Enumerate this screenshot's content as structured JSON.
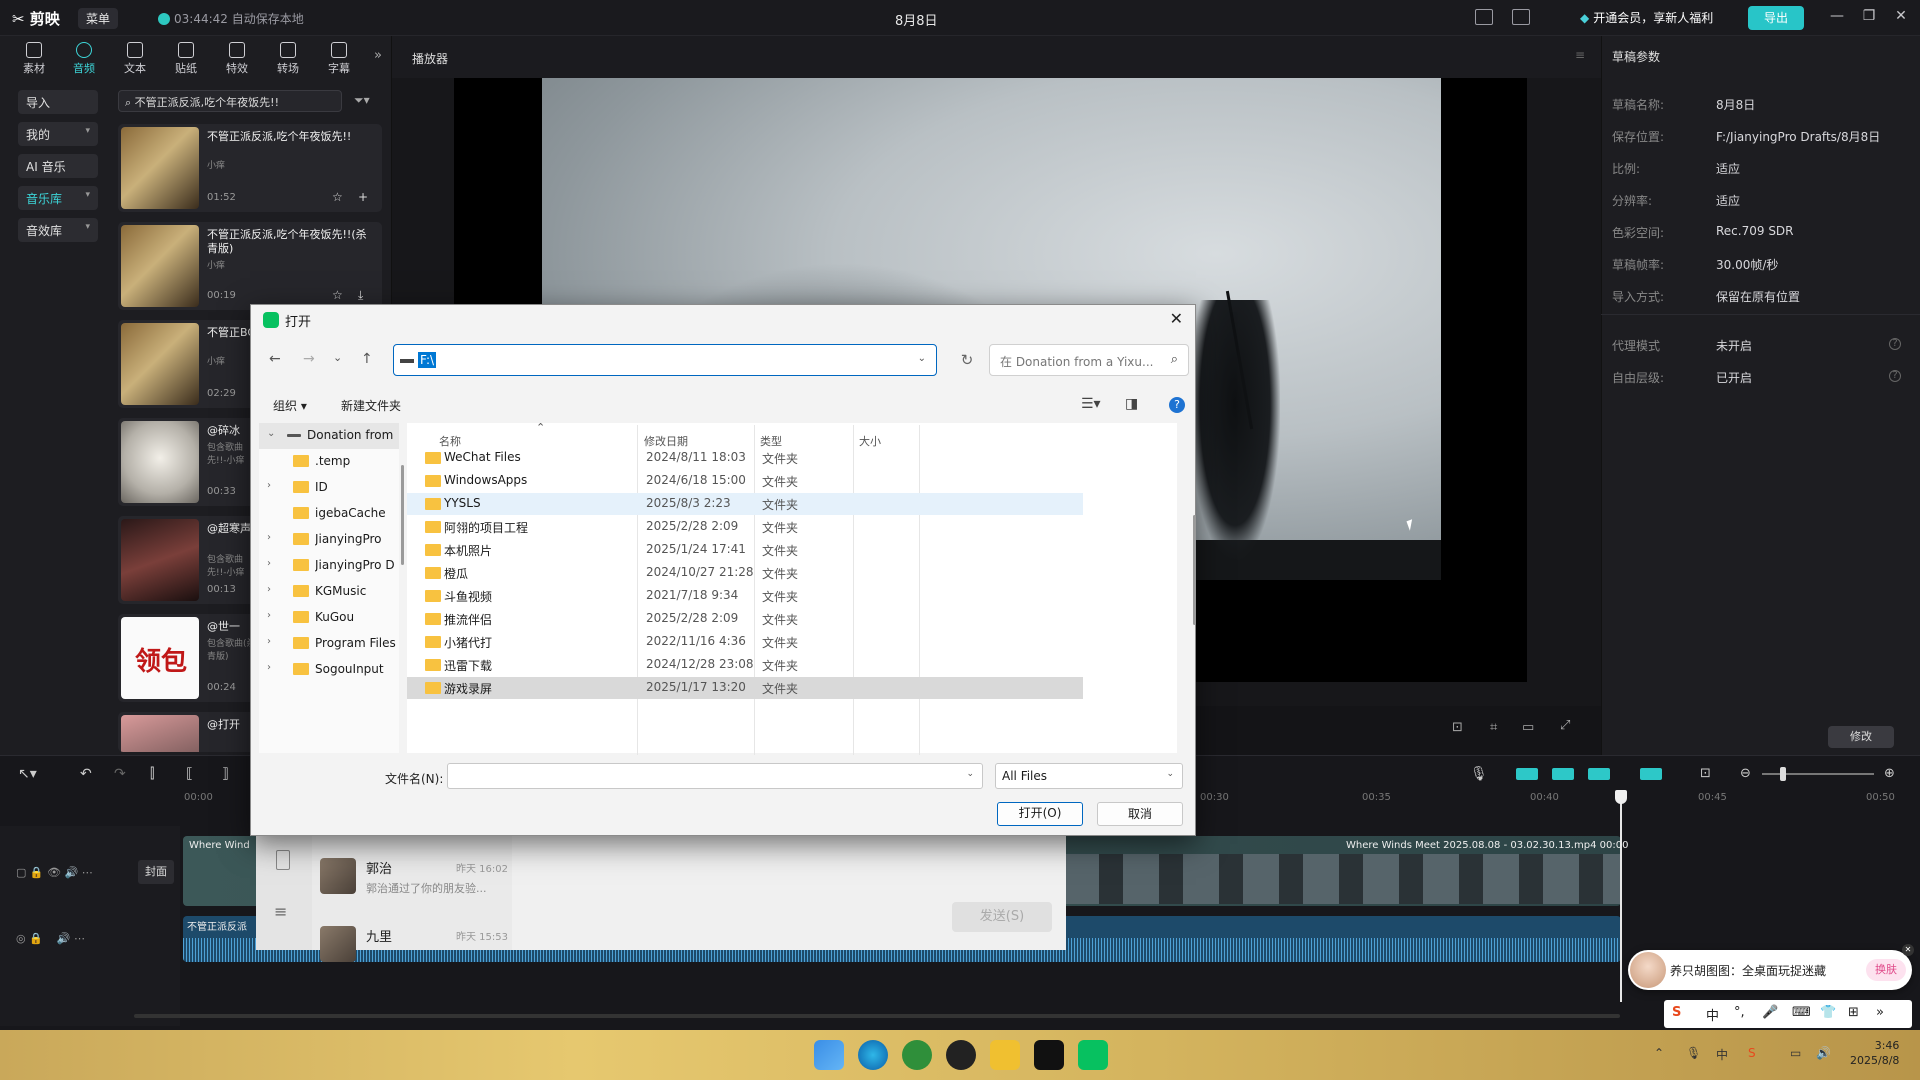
{
  "app": {
    "logo": "✂ 剪映",
    "menu": "菜单",
    "autosave": "03:44:42 自动保存本地",
    "doc_title": "8月8日",
    "vip": "开通会员，享新人福利",
    "export": "导出"
  },
  "toolbar": [
    {
      "label": "素材"
    },
    {
      "label": "音频"
    },
    {
      "label": "文本"
    },
    {
      "label": "贴纸"
    },
    {
      "label": "特效"
    },
    {
      "label": "转场"
    },
    {
      "label": "字幕"
    }
  ],
  "sidebar": [
    {
      "label": "导入",
      "chev": ""
    },
    {
      "label": "我的",
      "chev": "▾"
    },
    {
      "label": "AI 音乐",
      "chev": ""
    },
    {
      "label": "音乐库",
      "chev": "▾"
    },
    {
      "label": "音效库",
      "chev": "▾"
    }
  ],
  "music_search": "不管正派反派,吃个年夜饭先!!",
  "music_list": [
    {
      "title": "不管正派反派,吃个年夜饭先!!",
      "sub": "小痒",
      "dur": "01:52"
    },
    {
      "title": "不管正派反派,吃个年夜饭先!!(杀青版)",
      "sub": "小痒",
      "dur": "00:19"
    },
    {
      "title": "不管正BGM官",
      "sub": "小痒",
      "dur": "02:29"
    },
    {
      "title": "@碎冰",
      "sub": "包含歌曲先!!-小痒",
      "dur": "00:33"
    },
    {
      "title": "@超寒声",
      "sub": "包含歌曲先!!-小痒",
      "dur": "00:13"
    },
    {
      "title": "@世一",
      "sub": "包含歌曲(杀青版)",
      "dur": "00:24"
    },
    {
      "title": "@打开",
      "sub": "",
      "dur": ""
    }
  ],
  "player": {
    "title": "播放器"
  },
  "draft": {
    "title": "草稿参数",
    "rows": [
      {
        "k": "草稿名称:",
        "v": "8月8日"
      },
      {
        "k": "保存位置:",
        "v": "F:/JianyingPro Drafts/8月8日"
      },
      {
        "k": "比例:",
        "v": "适应"
      },
      {
        "k": "分辨率:",
        "v": "适应"
      },
      {
        "k": "色彩空间:",
        "v": "Rec.709 SDR"
      },
      {
        "k": "草稿帧率:",
        "v": "30.00帧/秒"
      },
      {
        "k": "导入方式:",
        "v": "保留在原有位置"
      }
    ],
    "rows2": [
      {
        "k": "代理模式",
        "v": "未开启"
      },
      {
        "k": "自由层级:",
        "v": "已开启"
      }
    ],
    "modify": "修改"
  },
  "timeline": {
    "ruler": [
      "00:00",
      "00:30",
      "00:35",
      "00:40",
      "00:45",
      "00:50"
    ],
    "cover": "封面",
    "video_clip": "Where Winds Meet 2025.08.08 - 03.02.30.13.mp4  00:00",
    "video_clip_left": "Where Wind",
    "audio_clip_left": "不管正派反派"
  },
  "chat": {
    "items": [
      {
        "name": "郭治",
        "time": "昨天 16:02",
        "msg": "郭治通过了你的朋友验..."
      },
      {
        "name": "九里",
        "time": "昨天 15:53",
        "msg": ""
      }
    ],
    "send": "发送(S)"
  },
  "dialog": {
    "title": "打开",
    "address": "F:\\",
    "search_placeholder": "在 Donation from a Yixu...",
    "organize": "组织 ▾",
    "new_folder": "新建文件夹",
    "headers": {
      "name": "名称",
      "date": "修改日期",
      "type": "类型",
      "size": "大小"
    },
    "tree": [
      {
        "label": "Donation from",
        "twisty": "⌄",
        "root": true
      },
      {
        "label": ".temp",
        "twisty": ""
      },
      {
        "label": "ID",
        "twisty": "›"
      },
      {
        "label": "igebaCache",
        "twisty": ""
      },
      {
        "label": "JianyingPro",
        "twisty": "›"
      },
      {
        "label": "JianyingPro D",
        "twisty": "›"
      },
      {
        "label": "KGMusic",
        "twisty": "›"
      },
      {
        "label": "KuGou",
        "twisty": "›"
      },
      {
        "label": "Program Files",
        "twisty": "›"
      },
      {
        "label": "SogouInput",
        "twisty": "›"
      }
    ],
    "files": [
      {
        "name": "WeChat Files",
        "date": "2024/8/11 18:03",
        "type": "文件夹"
      },
      {
        "name": "WindowsApps",
        "date": "2024/6/18 15:00",
        "type": "文件夹"
      },
      {
        "name": "YYSLS",
        "date": "2025/8/3 2:23",
        "type": "文件夹"
      },
      {
        "name": "阿翎的项目工程",
        "date": "2025/2/28 2:09",
        "type": "文件夹"
      },
      {
        "name": "本机照片",
        "date": "2025/1/24 17:41",
        "type": "文件夹"
      },
      {
        "name": "橙瓜",
        "date": "2024/10/27 21:28",
        "type": "文件夹"
      },
      {
        "name": "斗鱼视频",
        "date": "2021/7/18 9:34",
        "type": "文件夹"
      },
      {
        "name": "推流伴侣",
        "date": "2025/2/28 2:09",
        "type": "文件夹"
      },
      {
        "name": "小猪代打",
        "date": "2022/11/16 4:36",
        "type": "文件夹"
      },
      {
        "name": "迅雷下载",
        "date": "2024/12/28 23:08",
        "type": "文件夹"
      },
      {
        "name": "游戏录屏",
        "date": "2025/1/17 13:20",
        "type": "文件夹"
      }
    ],
    "filename_label": "文件名(N):",
    "filename_value": "",
    "filetype": "All Files",
    "open": "打开(O)",
    "cancel": "取消"
  },
  "toast": {
    "text": "养只胡图图：全桌面玩捉迷藏",
    "skin": "换肤"
  },
  "ime": {
    "items": [
      "中",
      "°,",
      "🎤",
      "⌨"
    ]
  },
  "clock": {
    "time": "3:46",
    "date": "2025/8/8"
  },
  "colors": {
    "accent": "#28c5c8",
    "dialog_accent": "#0067c0",
    "folder": "#f8c240"
  }
}
